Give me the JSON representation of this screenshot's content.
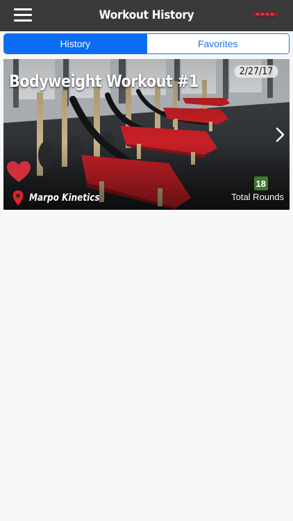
{
  "header": {
    "title": "Workout History",
    "menu_icon": "hamburger-menu-icon",
    "logo": "brand-logo"
  },
  "tabs": [
    {
      "label": "History",
      "active": true
    },
    {
      "label": "Favorites",
      "active": false
    }
  ],
  "workouts": [
    {
      "title": "Bodyweight Workout #1",
      "date": "2/27/17",
      "location": "Marpo Kinetics",
      "rounds_count": "18",
      "rounds_label": "Total Rounds",
      "favorite": true
    }
  ],
  "colors": {
    "navbar": "#3a3a3a",
    "accent": "#0a6cf2",
    "favorite": "#d0303a",
    "badge": "#3d7a2a",
    "background": "#f7f7f7"
  }
}
